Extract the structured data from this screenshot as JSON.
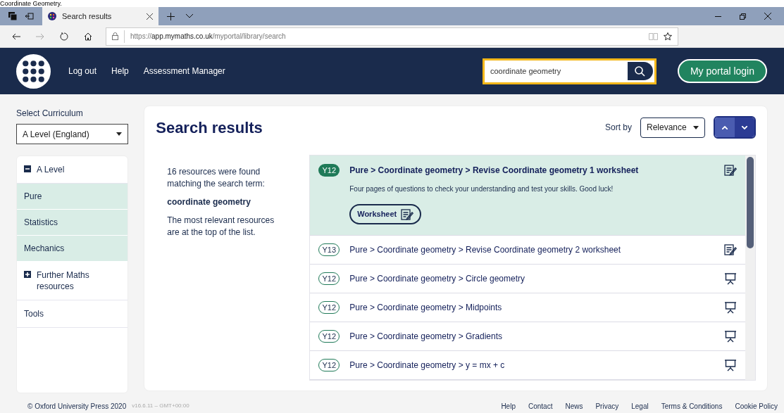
{
  "caption": "Coordinate Geometry.",
  "browser": {
    "tab_title": "Search results",
    "url_prefix": "https://",
    "url_host": "app.mymaths.co.uk",
    "url_path": "/myportal/library/search"
  },
  "header": {
    "nav": [
      "Log out",
      "Help",
      "Assessment Manager"
    ],
    "search_value": "coordinate geometry",
    "login_button": "My portal login"
  },
  "sidebar": {
    "curriculum_label": "Select Curriculum",
    "curriculum_value": "A Level (England)",
    "items": [
      {
        "label": "A Level",
        "expanded": true,
        "children": [
          {
            "label": "Pure"
          },
          {
            "label": "Statistics"
          },
          {
            "label": "Mechanics"
          }
        ]
      },
      {
        "label": "Further Maths resources",
        "expanded": false
      },
      {
        "label": "Tools"
      }
    ]
  },
  "content": {
    "title": "Search results",
    "sort_label": "Sort by",
    "sort_value": "Relevance",
    "sort_buttons": [
      {
        "kind": "up",
        "selected": true
      },
      {
        "kind": "down",
        "selected": false
      }
    ],
    "summary": "16 resources were found matching the search term:",
    "term": "coordinate geometry",
    "note": "The most relevant resources are at the top of the list.",
    "results": [
      {
        "year": "Y12",
        "path": "Pure > Coordinate geometry > Revise Coordinate geometry 1 worksheet",
        "kind": "worksheet",
        "selected": true,
        "description": "Four pages of questions to check your understanding and test your skills. Good luck!",
        "button": "Worksheet"
      },
      {
        "year": "Y13",
        "path": "Pure > Coordinate geometry > Revise Coordinate geometry 2 worksheet",
        "kind": "worksheet",
        "selected": false
      },
      {
        "year": "Y12",
        "path": "Pure > Coordinate geometry > Circle geometry",
        "kind": "lesson",
        "selected": false
      },
      {
        "year": "Y12",
        "path": "Pure > Coordinate geometry > Midpoints",
        "kind": "lesson",
        "selected": false
      },
      {
        "year": "Y12",
        "path": "Pure > Coordinate geometry > Gradients",
        "kind": "lesson",
        "selected": false
      },
      {
        "year": "Y12",
        "path": "Pure > Coordinate geometry > y = mx + c",
        "kind": "lesson",
        "selected": false
      }
    ]
  },
  "footer": {
    "copyright": "© Oxford University Press 2020",
    "version": "v16.6.11 – GMT+00:00",
    "links": [
      "Help",
      "Contact",
      "News",
      "Privacy",
      "Legal",
      "Terms & Conditions",
      "Cookie Policy"
    ]
  }
}
